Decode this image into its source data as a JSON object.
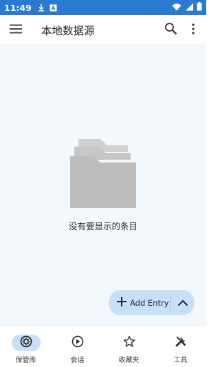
{
  "status_bar": {
    "time": "11:49",
    "icons": [
      "download-icon",
      "app-notification-icon",
      "wifi-icon",
      "signal-icon",
      "battery-icon"
    ],
    "background": "#2a7bd0"
  },
  "toolbar": {
    "title": "本地数据源",
    "icons": [
      "menu-icon",
      "search-icon",
      "more-vert-icon"
    ]
  },
  "main": {
    "empty_icon": "folder-icon",
    "empty_message": "没有要显示的条目",
    "background": "#f3f8fd"
  },
  "fab": {
    "icon": "plus-icon",
    "label": "Add Entry",
    "expand_icon": "chevron-up-icon",
    "color": "#c7e0f7"
  },
  "bottom_nav": {
    "items": [
      {
        "label": "保管库",
        "icon": "vault-icon",
        "active": true
      },
      {
        "label": "会话",
        "icon": "play-circle-icon",
        "active": false
      },
      {
        "label": "收藏夹",
        "icon": "star-icon",
        "active": false
      },
      {
        "label": "工具",
        "icon": "tools-icon",
        "active": false
      }
    ]
  }
}
